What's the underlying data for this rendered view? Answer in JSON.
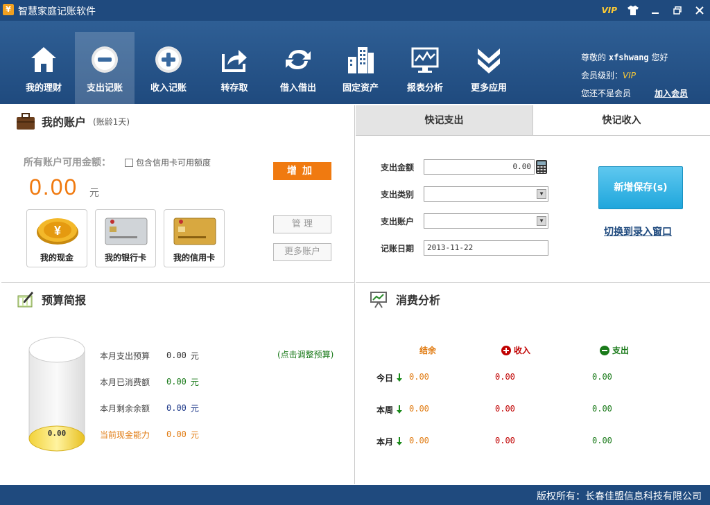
{
  "window": {
    "title": "智慧家庭记账软件",
    "vip_badge": "VIP"
  },
  "toolbar": {
    "items": [
      {
        "label": "我的理财",
        "icon": "home-icon"
      },
      {
        "label": "支出记账",
        "icon": "minus-circle-icon",
        "active": true
      },
      {
        "label": "收入记账",
        "icon": "plus-circle-icon"
      },
      {
        "label": "转存取",
        "icon": "share-arrow-icon"
      },
      {
        "label": "借入借出",
        "icon": "refresh-arrows-icon"
      },
      {
        "label": "固定资产",
        "icon": "buildings-icon"
      },
      {
        "label": "报表分析",
        "icon": "chart-monitor-icon"
      },
      {
        "label": "更多应用",
        "icon": "double-chevron-down-icon"
      }
    ]
  },
  "user": {
    "greeting_prefix": "尊敬的",
    "username": "xfshwang",
    "greeting_suffix": "您好",
    "level_label": "会员级别：",
    "level_value": "VIP",
    "not_member": "您还不是会员",
    "join_link": "加入会员"
  },
  "accounts": {
    "title": "我的账户",
    "age": "(账龄1天)",
    "available_label": "所有账户可用金额：",
    "credit_checkbox_label": "包含信用卡可用额度",
    "amount": "0.00",
    "amount_unit": "元",
    "add_button": "增加",
    "manage_button": "管 理",
    "more_button": "更多账户",
    "cards": [
      {
        "label": "我的现金",
        "icon": "cash-coin-icon"
      },
      {
        "label": "我的银行卡",
        "icon": "bank-card-icon"
      },
      {
        "label": "我的信用卡",
        "icon": "credit-card-icon"
      }
    ]
  },
  "quick": {
    "tab_expense": "快记支出",
    "tab_income": "快记收入",
    "amount_label": "支出金额",
    "amount_value": "0.00",
    "category_label": "支出类别",
    "account_label": "支出账户",
    "date_label": "记账日期",
    "date_value": "2013-11-22",
    "save_button": "新增保存(s)",
    "switch_link": "切换到录入窗口"
  },
  "budget": {
    "title": "预算简报",
    "cylinder_value": "0.00",
    "adjust_link": "(点击调整预算)",
    "rows": [
      {
        "label": "本月支出预算",
        "value": "0.00",
        "unit": "元",
        "label_color": "#444444",
        "value_color": "#333333"
      },
      {
        "label": "本月已消费额",
        "value": "0.00",
        "unit": "元",
        "label_color": "#444444",
        "value_color": "#1a7a1a"
      },
      {
        "label": "本月剩余余额",
        "value": "0.00",
        "unit": "元",
        "label_color": "#444444",
        "value_color": "#1f3a8a"
      },
      {
        "label": "当前现金能力",
        "value": "0.00",
        "unit": "元",
        "label_color": "#e07a10",
        "value_color": "#e07a10"
      }
    ]
  },
  "analysis": {
    "title": "消费分析",
    "col_balance": "结余",
    "col_income": "收入",
    "col_expense": "支出",
    "rows": [
      {
        "label": "今日",
        "balance": "0.00",
        "income": "0.00",
        "expense": "0.00"
      },
      {
        "label": "本周",
        "balance": "0.00",
        "income": "0.00",
        "expense": "0.00"
      },
      {
        "label": "本月",
        "balance": "0.00",
        "income": "0.00",
        "expense": "0.00"
      }
    ]
  },
  "status": {
    "copyright": "版权所有：长春佳盟信息科技有限公司"
  },
  "colors": {
    "brand_blue": "#1f4a7e",
    "accent_orange": "#f07a10",
    "save_blue": "#1ea6dc",
    "income_red": "#c00000",
    "expense_green": "#1a7a1a"
  }
}
